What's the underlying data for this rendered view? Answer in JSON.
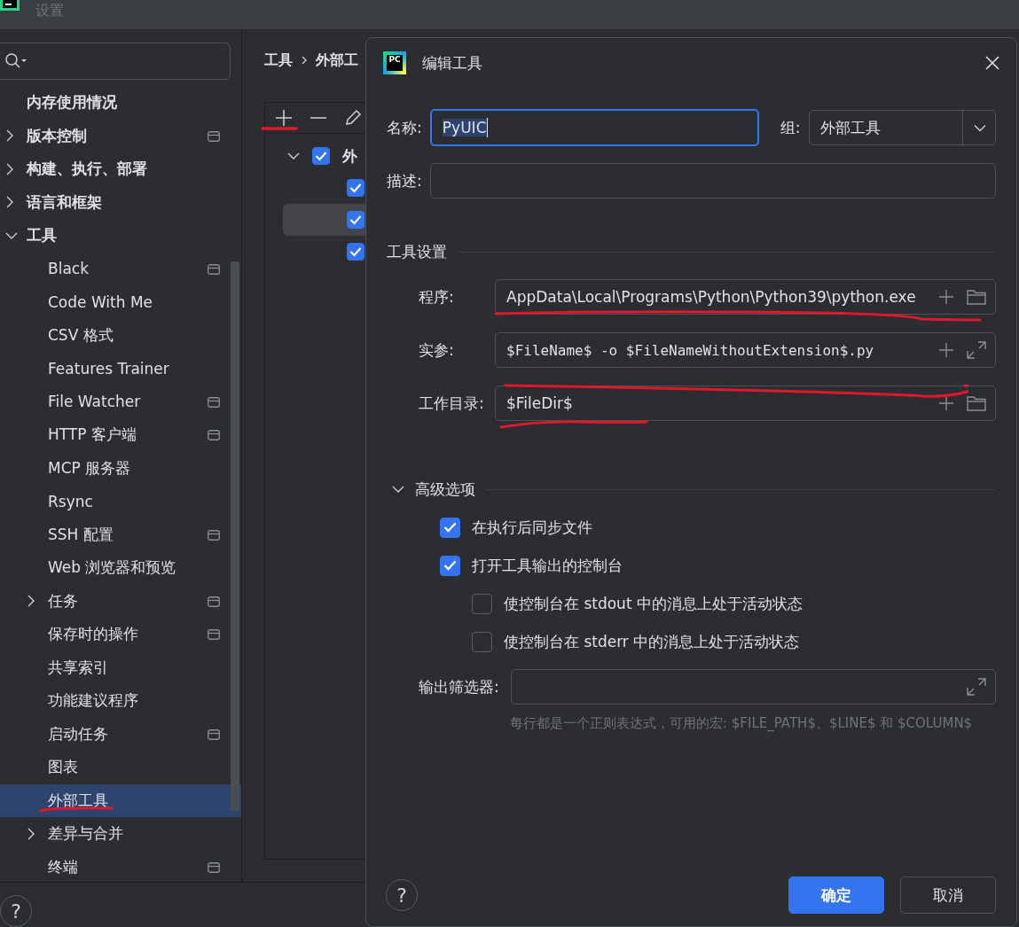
{
  "window": {
    "title": "设置"
  },
  "sidebar": {
    "items": [
      {
        "label": "内存使用情况",
        "project_scope": false,
        "selected": false
      },
      {
        "label": "版本控制",
        "expanded": false,
        "project_scope": true,
        "selected": false
      },
      {
        "label": "构建、执行、部署",
        "expanded": false,
        "project_scope": false,
        "selected": false
      },
      {
        "label": "语言和框架",
        "expanded": false,
        "project_scope": false,
        "selected": false
      },
      {
        "label": "工具",
        "expanded": true,
        "project_scope": false,
        "selected": false,
        "children": [
          {
            "label": "Black",
            "project_scope": true,
            "selected": false
          },
          {
            "label": "Code With Me",
            "project_scope": false,
            "selected": false
          },
          {
            "label": "CSV 格式",
            "project_scope": false,
            "selected": false
          },
          {
            "label": "Features Trainer",
            "project_scope": false,
            "selected": false
          },
          {
            "label": "File Watcher",
            "project_scope": true,
            "selected": false
          },
          {
            "label": "HTTP 客户端",
            "project_scope": true,
            "selected": false
          },
          {
            "label": "MCP 服务器",
            "project_scope": false,
            "selected": false
          },
          {
            "label": "Rsync",
            "project_scope": false,
            "selected": false
          },
          {
            "label": "SSH 配置",
            "project_scope": true,
            "selected": false
          },
          {
            "label": "Web 浏览器和预览",
            "project_scope": false,
            "selected": false
          },
          {
            "label": "任务",
            "expanded": false,
            "project_scope": true,
            "selected": false
          },
          {
            "label": "保存时的操作",
            "project_scope": true,
            "selected": false
          },
          {
            "label": "共享索引",
            "project_scope": false,
            "selected": false
          },
          {
            "label": "功能建议程序",
            "project_scope": false,
            "selected": false
          },
          {
            "label": "启动任务",
            "project_scope": true,
            "selected": false
          },
          {
            "label": "图表",
            "project_scope": false,
            "selected": false
          },
          {
            "label": "外部工具",
            "project_scope": false,
            "selected": true
          },
          {
            "label": "差异与合并",
            "expanded": false,
            "project_scope": false,
            "selected": false
          },
          {
            "label": "终端",
            "project_scope": true,
            "selected": false
          }
        ]
      }
    ]
  },
  "help_button": {
    "label": "?"
  },
  "breadcrumb": [
    "工具",
    "外部工"
  ],
  "tool_tree": {
    "label": "外",
    "checked": true,
    "expanded": true,
    "children": [
      {
        "checked": true,
        "selected": false
      },
      {
        "checked": true,
        "selected": true
      },
      {
        "checked": true,
        "selected": false
      }
    ]
  },
  "dialog": {
    "app_icon_text": "PC",
    "title": "编辑工具",
    "name": {
      "label": "名称:",
      "value": "PyUIC",
      "focused": true,
      "text_selected": true
    },
    "group": {
      "label": "组:",
      "value": "外部工具"
    },
    "description": {
      "label": "描述:"
    },
    "tool_settings": {
      "title": "工具设置",
      "rows": [
        {
          "kind": "path",
          "label": "程序:",
          "value": "AppData\\Local\\Programs\\Python\\Python39\\python.exe"
        },
        {
          "kind": "args",
          "label": "实参:",
          "value": "$FileName$ -o $FileNameWithoutExtension$.py"
        },
        {
          "kind": "path",
          "label": "工作目录:",
          "value": "$FileDir$"
        }
      ]
    },
    "advanced": {
      "title": "高级选项",
      "expanded": true,
      "options": [
        {
          "label": "在执行后同步文件",
          "checked": true
        },
        {
          "label": "打开工具输出的控制台",
          "checked": true,
          "children": [
            {
              "label": "使控制台在 stdout 中的消息上处于活动状态",
              "checked": false
            },
            {
              "label": "使控制台在 stderr 中的消息上处于活动状态",
              "checked": false
            }
          ]
        }
      ],
      "output_filter": {
        "label": "输出筛选器:",
        "hint": "每行都是一个正则表达式，可用的宏: $FILE_PATH$、$LINE$ 和 $COLUMN$"
      }
    },
    "help_button": {
      "label": "?"
    },
    "buttons": [
      {
        "label": "确定",
        "kind": "primary"
      },
      {
        "label": "取消",
        "kind": "secondary"
      }
    ]
  }
}
